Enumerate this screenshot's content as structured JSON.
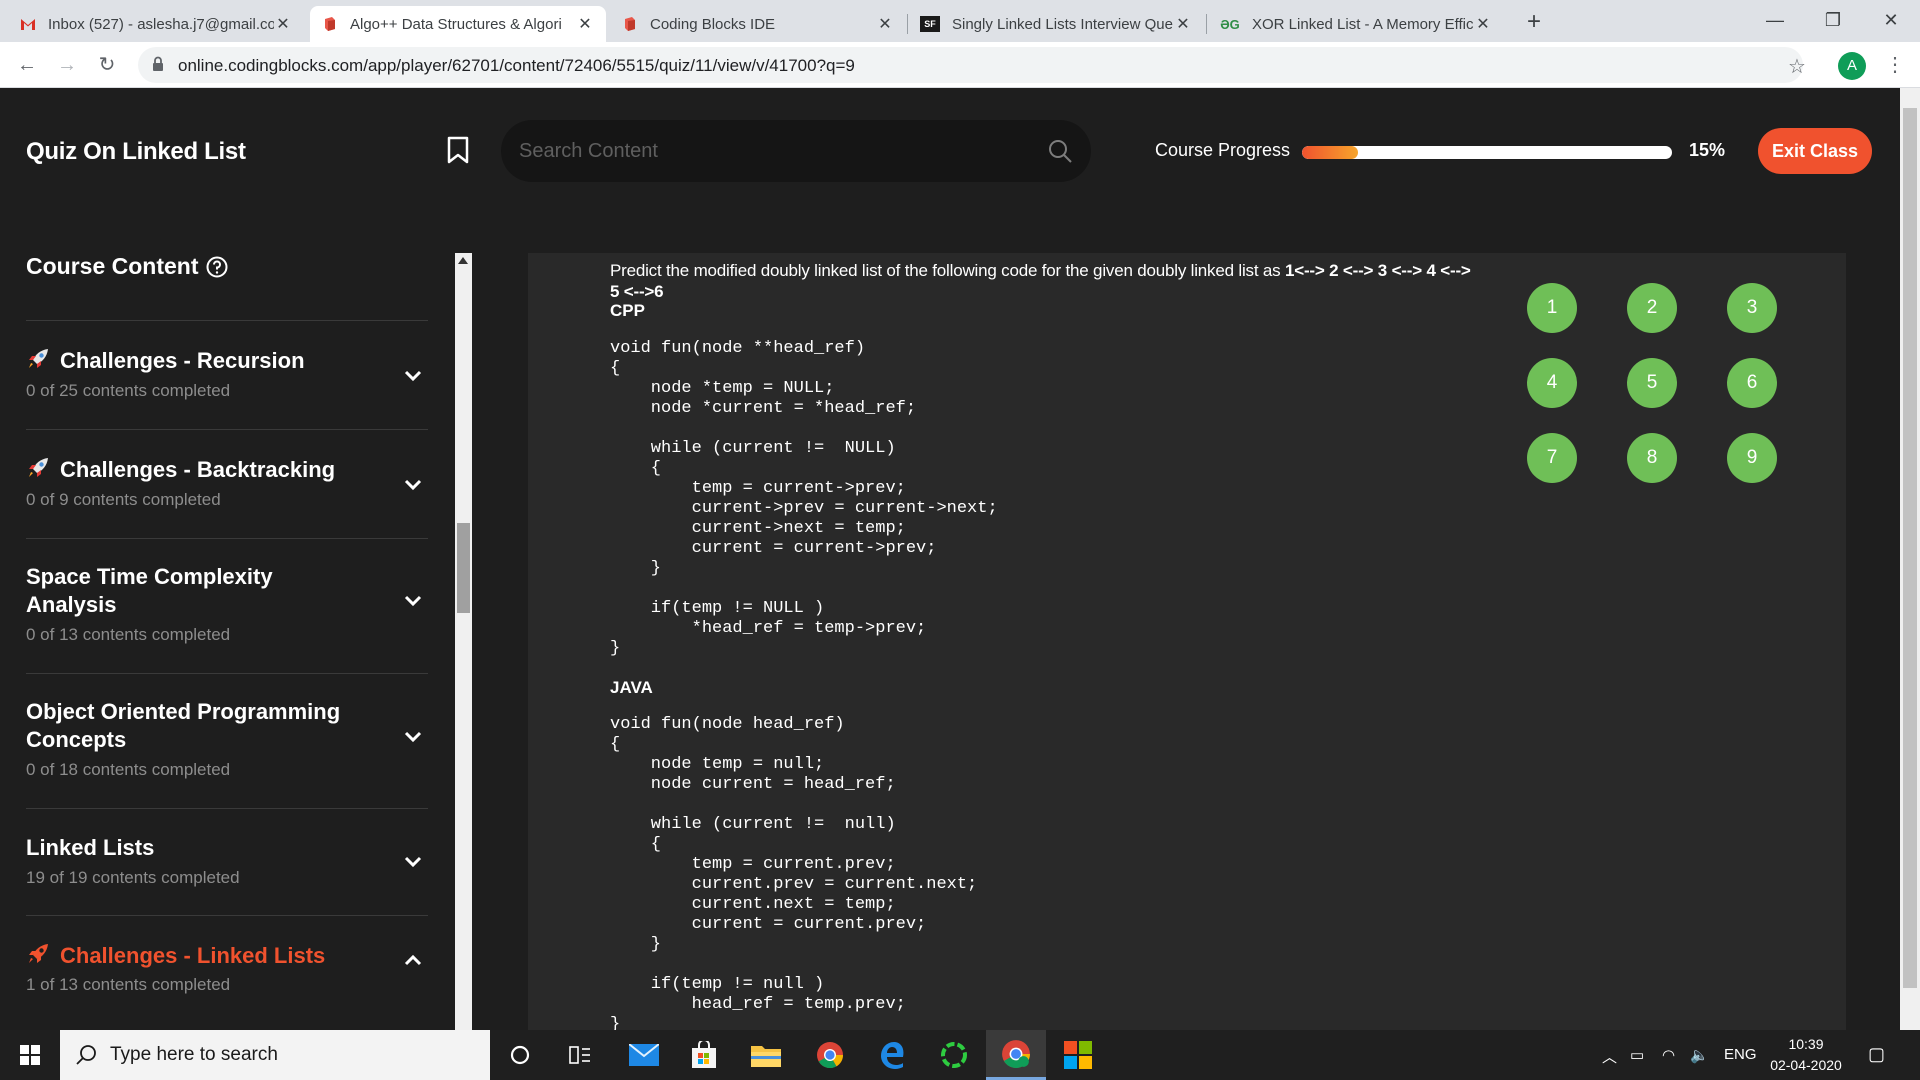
{
  "browser": {
    "tabs": [
      {
        "title": "Inbox (527) - aslesha.j7@gmail.co",
        "favicon": "gmail-icon",
        "active": false
      },
      {
        "title": "Algo++ Data Structures & Algori",
        "favicon": "codingblocks-icon",
        "active": true
      },
      {
        "title": "Coding Blocks IDE",
        "favicon": "codingblocks-icon",
        "active": false
      },
      {
        "title": "Singly Linked Lists Interview Que",
        "favicon": "sf-icon",
        "active": false
      },
      {
        "title": "XOR Linked List - A Memory Effic",
        "favicon": "gfg-icon",
        "active": false
      }
    ],
    "url": "online.codingblocks.com/app/player/62701/content/72406/5515/quiz/11/view/v/41700?q=9",
    "profile_initial": "A"
  },
  "header": {
    "title": "Quiz On Linked List",
    "search_placeholder": "Search Content",
    "progress_label": "Course Progress",
    "progress_value": 15,
    "progress_text": "15%",
    "exit_label": "Exit Class"
  },
  "sidebar": {
    "title": "Course Content",
    "sections": [
      {
        "title": "Challenges - Recursion",
        "subtitle": "0 of 25 contents completed",
        "rocket": true,
        "expanded": false
      },
      {
        "title": "Challenges - Backtracking",
        "subtitle": "0 of 9 contents completed",
        "rocket": true,
        "expanded": false
      },
      {
        "title": "Space Time Complexity Analysis",
        "subtitle": "0 of 13 contents completed",
        "rocket": false,
        "expanded": false
      },
      {
        "title": "Object Oriented Programming Concepts",
        "subtitle": "0 of 18 contents completed",
        "rocket": false,
        "expanded": false
      },
      {
        "title": "Linked Lists",
        "subtitle": "19 of 19 contents completed",
        "rocket": false,
        "expanded": false
      },
      {
        "title": "Challenges - Linked Lists",
        "subtitle": "1 of 13 contents completed",
        "rocket": true,
        "expanded": true
      }
    ]
  },
  "question": {
    "text_prefix": "Predict the modified doubly linked list of the following code for the given doubly linked list as ",
    "text_bold": "1<--> 2 <--> 3 <--> 4 <--> 5 <-->6",
    "cpp_label": "CPP",
    "cpp_code": "void fun(node **head_ref)\n{\n    node *temp = NULL;\n    node *current = *head_ref;\n\n    while (current !=  NULL)\n    {\n        temp = current->prev;\n        current->prev = current->next;\n        current->next = temp;\n        current = current->prev;\n    }\n\n    if(temp != NULL )\n        *head_ref = temp->prev;\n}",
    "java_label": "JAVA",
    "java_code": "void fun(node head_ref)\n{\n    node temp = null;\n    node current = head_ref;\n\n    while (current !=  null)\n    {\n        temp = current.prev;\n        current.prev = current.next;\n        current.next = temp;\n        current = current.prev;\n    }\n\n    if(temp != null )\n        head_ref = temp.prev;\n}"
  },
  "question_numbers": [
    "1",
    "2",
    "3",
    "4",
    "5",
    "6",
    "7",
    "8",
    "9"
  ],
  "taskbar": {
    "search_placeholder": "Type here to search",
    "language": "ENG",
    "time": "10:39",
    "date": "02-04-2020"
  },
  "colors": {
    "accent": "#f0522e",
    "question_done": "#6fbf57",
    "background": "#1e1e1e",
    "panel": "#292929"
  }
}
